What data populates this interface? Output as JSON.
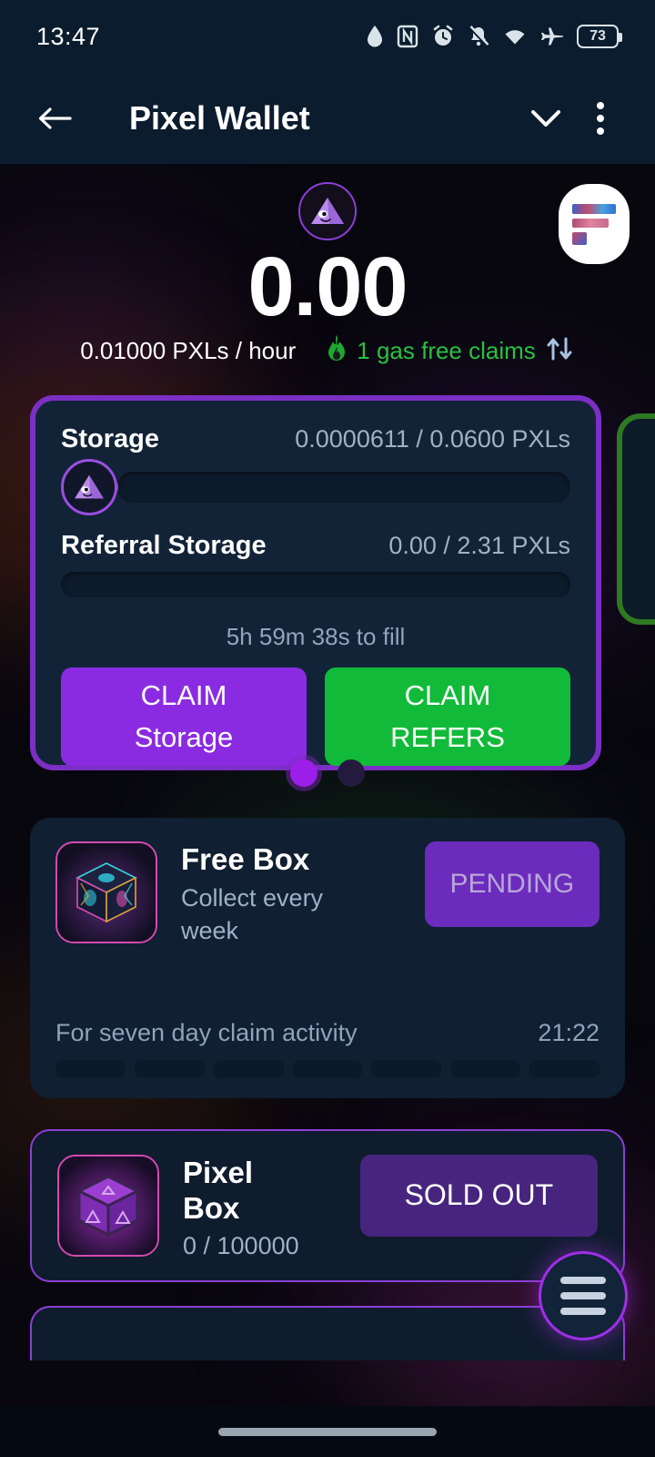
{
  "statusbar": {
    "time": "13:47",
    "battery_level": "73",
    "icons": [
      "water-drop-icon",
      "nfc-icon",
      "alarm-icon",
      "notifications-off-icon",
      "wifi-icon",
      "airplane-mode-icon",
      "battery-icon"
    ]
  },
  "appbar": {
    "back_icon": "back-arrow-icon",
    "title": "Pixel Wallet",
    "dropdown_icon": "chevron-down-icon",
    "overflow_icon": "more-vertical-icon"
  },
  "balance": {
    "amount": "0.00",
    "rate": "0.01000 PXLs / hour",
    "gas_claims": "1 gas free claims",
    "flame_icon": "flame-icon",
    "swap_icon": "swap-vertical-icon",
    "token_icon": "pixel-triangle-icon",
    "profile_icon": "profile-avatar-icon"
  },
  "storage_card": {
    "storage_label": "Storage",
    "storage_value": "0.0000611 / 0.0600 PXLs",
    "storage_percent": 0.1,
    "referral_label": "Referral Storage",
    "referral_value": "0.00 / 2.31 PXLs",
    "referral_percent": 0,
    "fill_timer": "5h 59m 38s to fill",
    "claim_storage_line1": "CLAIM",
    "claim_storage_line2": "Storage",
    "claim_refers_line1": "CLAIM",
    "claim_refers_line2": "REFERS"
  },
  "pager": {
    "total": 2,
    "active": 0
  },
  "free_box": {
    "title": "Free Box",
    "description": "Collect every week",
    "action_label": "PENDING",
    "activity_text": "For seven day claim activity",
    "activity_timer": "21:22",
    "segments": 7,
    "thumb_icon": "loot-box-icon"
  },
  "pixel_box": {
    "title": "Pixel Box",
    "supply": "0 / 100000",
    "action_label": "SOLD OUT",
    "thumb_icon": "pixel-box-icon"
  },
  "fab": {
    "icon": "hamburger-menu-icon"
  },
  "colors": {
    "accent_purple": "#8a2be2",
    "accent_green": "#11bb39",
    "card_bg": "#122337",
    "appbar_bg": "#0b1c2e",
    "muted_text": "#9eb2c7"
  }
}
